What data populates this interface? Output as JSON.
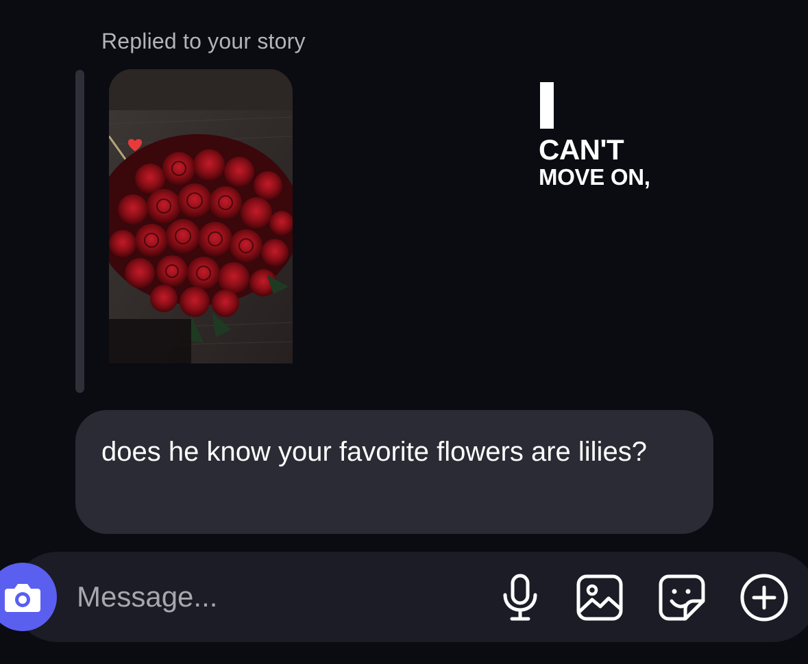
{
  "reply": {
    "caption": "Replied to your story"
  },
  "story": {
    "text_line_1": "I",
    "text_line_2": "CAN'T",
    "text_line_3": "MOVE ON,"
  },
  "message": {
    "text": "does he know your favorite flowers are lilies?"
  },
  "composer": {
    "placeholder": "Message...",
    "icons": [
      "camera-icon",
      "microphone-icon",
      "gallery-icon",
      "sticker-icon",
      "plus-icon"
    ]
  },
  "colors": {
    "background": "#0b0b12",
    "bubble": "#2a2b34",
    "composer": "#1b1c25",
    "camera_accent": "#5a5ff0",
    "reply_caption": "#b3b3bb"
  }
}
